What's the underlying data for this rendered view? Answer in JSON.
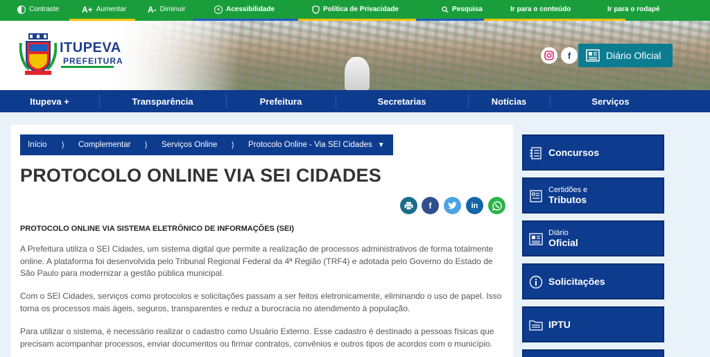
{
  "topbar": {
    "contrast": "Contraste",
    "increase_glyph": "A+",
    "increase": "Aumentar",
    "decrease_glyph": "A-",
    "decrease": "Diminuir",
    "accessibility": "Acessibilidade",
    "privacy": "Política de Privacidade",
    "search": "Pesquisa",
    "skip_content": "Ir para o conteúdo",
    "skip_footer": "Ir para o rodapé",
    "accent_colors": [
      "#f2c200",
      "#1d5fbf",
      "#f2c200",
      "#1d5fbf",
      "#f2c200"
    ]
  },
  "header": {
    "brand_name": "ITUPEVA",
    "brand_sub": "PREFEITURA",
    "diario": "Diário Oficial",
    "instagram_icon": "instagram-icon",
    "facebook_icon": "facebook-icon"
  },
  "nav": {
    "items": [
      "Itupeva +",
      "Transparência",
      "Prefeitura",
      "Secretarias",
      "Notícias",
      "Serviços"
    ]
  },
  "breadcrumb": {
    "items": [
      "Início",
      "Complementar",
      "Serviços Online",
      "Protocolo Online - Via SEI Cidades"
    ],
    "separator": "⟩",
    "dropdown_glyph": "▼"
  },
  "page": {
    "title": "PROTOCOLO ONLINE VIA SEI CIDADES",
    "subhead": "PROTOCOLO ONLINE VIA SISTEMA ELETRÔNICO DE INFORMAÇÕES (SEI)",
    "paragraphs": [
      "A Prefeitura utiliza o SEI Cidades, um sistema digital que permite a realização de processos administrativos de forma totalmente online. A plataforma foi desenvolvida pelo Tribunal Regional Federal da 4ª Região (TRF4) e adotada pelo Governo do Estado de São Paulo para modernizar a gestão pública municipal.",
      "Com o SEI Cidades, serviços como protocolos e solicitações passam a ser feitos eletronicamente, eliminando o uso de papel. Isso torna os processos mais ágeis, seguros, transparentes e reduz a burocracia no atendimento à população.",
      "Para utilizar o sistema, é necessário realizar o cadastro como Usuário Externo. Esse cadastro é destinado a pessoas físicas que precisam acompanhar processos, enviar documentos ou firmar contratos, convênios e outros tipos de acordos com o município."
    ]
  },
  "share": [
    {
      "icon": "print-icon",
      "color": "#1a6e8c"
    },
    {
      "icon": "facebook-icon",
      "color": "#2f4f8f"
    },
    {
      "icon": "twitter-icon",
      "color": "#4ba3e3"
    },
    {
      "icon": "linkedin-icon",
      "color": "#1466a8"
    },
    {
      "icon": "whatsapp-icon",
      "color": "#2db34a"
    }
  ],
  "sidebar": {
    "concursos": "Concursos",
    "certidoes_small": "Certidões e",
    "certidoes_big": "Tributos",
    "diario_small": "Diário",
    "diario_big": "Oficial",
    "solicitacoes": "Solicitações",
    "iptu": "IPTU"
  }
}
